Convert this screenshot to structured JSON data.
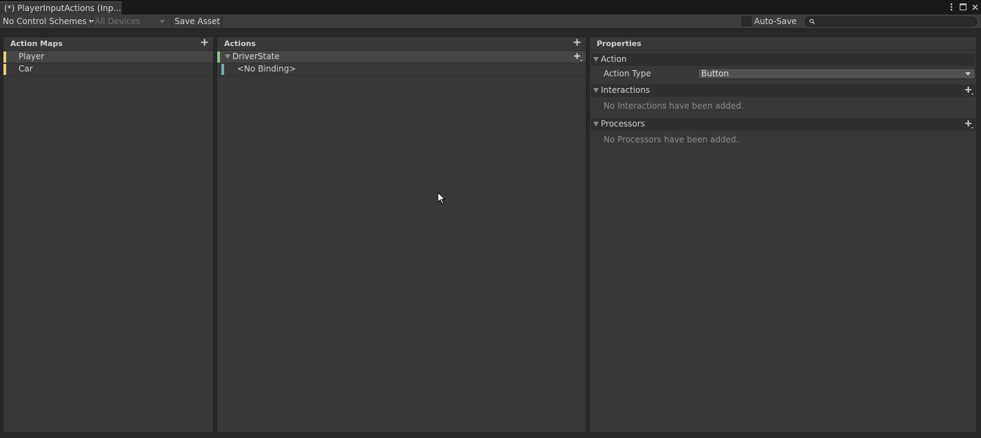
{
  "window": {
    "tab_title": "(*) PlayerInputActions (Inp...",
    "icons": [
      "more-vertical-icon",
      "maximize-icon",
      "close-icon"
    ]
  },
  "toolbar": {
    "control_schemes": "No Control Schemes",
    "devices": "All Devices",
    "save_asset": "Save Asset",
    "auto_save_label": "Auto-Save",
    "auto_save_checked": false,
    "search_value": ""
  },
  "action_maps": {
    "header": "Action Maps",
    "items": [
      {
        "label": "Player",
        "selected": true
      },
      {
        "label": "Car",
        "selected": false
      }
    ]
  },
  "actions": {
    "header": "Actions",
    "items": [
      {
        "label": "DriverState",
        "kind": "action"
      },
      {
        "label": "<No Binding>",
        "kind": "binding"
      }
    ]
  },
  "properties": {
    "header": "Properties",
    "action_section": "Action",
    "action_type_label": "Action Type",
    "action_type_value": "Button",
    "interactions_section": "Interactions",
    "interactions_empty": "No Interactions have been added.",
    "processors_section": "Processors",
    "processors_empty": "No Processors have been added."
  },
  "colors": {
    "action_map_accent": "#e8cf7a",
    "action_accent": "#8fc48c",
    "binding_accent": "#7ea9b6"
  }
}
